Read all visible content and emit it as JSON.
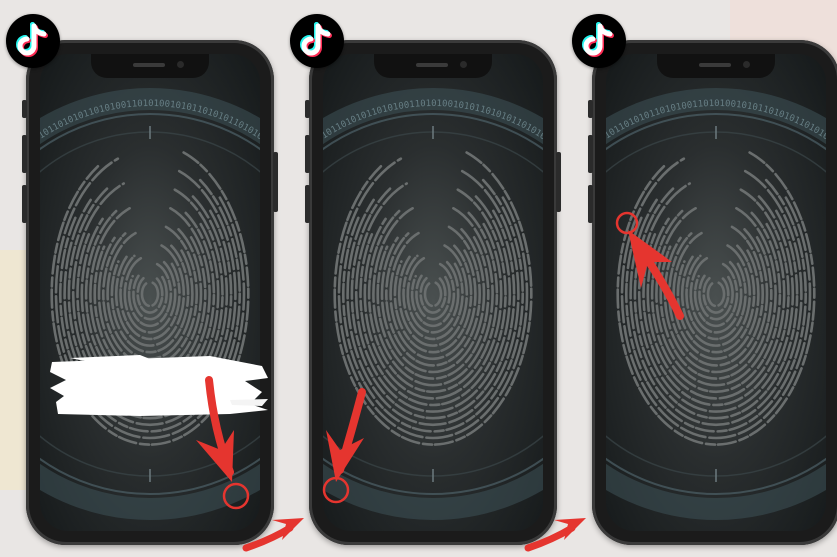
{
  "colors": {
    "background": "#e9e6e4",
    "accent_red": "#e5352f",
    "phone_body": "#1b1b1b",
    "fingerprint": "#6a6e6e"
  },
  "icons": {
    "logo": "tiktok-logo-icon",
    "pointer": "red-arrow-icon",
    "target": "red-circle-icon",
    "transition": "curved-arrow-icon"
  },
  "panels": [
    {
      "step": 1,
      "pointer_direction": "down",
      "target_corner": "bottom-right",
      "has_redaction": true
    },
    {
      "step": 2,
      "pointer_direction": "down",
      "target_corner": "bottom-left",
      "has_redaction": false
    },
    {
      "step": 3,
      "pointer_direction": "up",
      "target_corner": "top-left",
      "has_redaction": false
    }
  ],
  "ring_text": "101010010101101010110101001"
}
